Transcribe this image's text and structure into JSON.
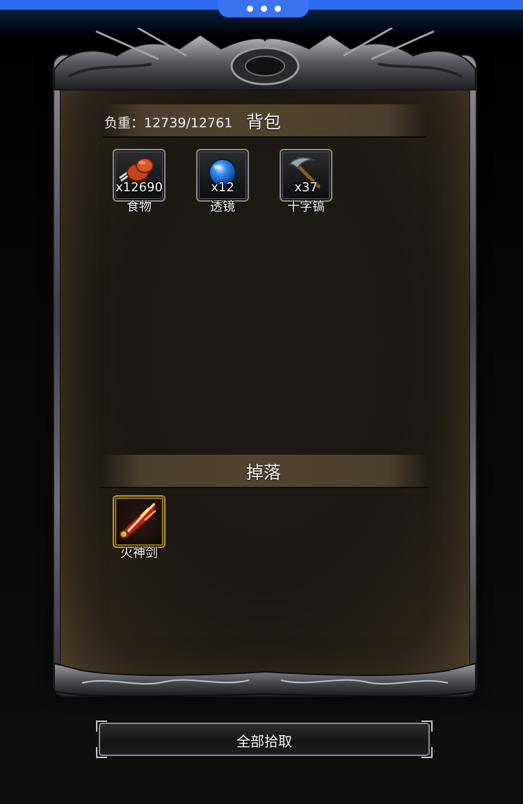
{
  "bag": {
    "weight_text": "负重：12739/12761",
    "title": "背包",
    "items": [
      {
        "name": "食物",
        "count": "x12690",
        "icon": "roasted-meat-icon"
      },
      {
        "name": "透镜",
        "count": "x12",
        "icon": "blue-lens-orb-icon"
      },
      {
        "name": "十字镐",
        "count": "x37",
        "icon": "pickaxe-icon"
      }
    ]
  },
  "drops": {
    "title": "掉落",
    "items": [
      {
        "name": "火神剑",
        "icon": "fire-sword-icon",
        "rarity_color": "#c9a431"
      }
    ]
  },
  "pickup_all_label": "全部拾取",
  "colors": {
    "system_bar": "#2d6cf0",
    "panel_header": "#51442f",
    "frame_metal": "#8e9095",
    "rare_border": "#c9a431"
  }
}
